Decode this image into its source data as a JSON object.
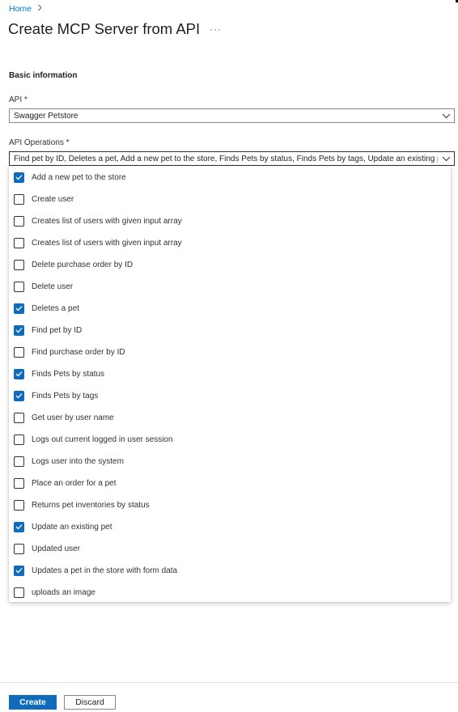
{
  "breadcrumb": {
    "home": "Home"
  },
  "page": {
    "title": "Create MCP Server from API",
    "more": "···"
  },
  "section": {
    "title": "Basic information"
  },
  "api_field": {
    "label": "API *",
    "value": "Swagger Petstore"
  },
  "operations_field": {
    "label": "API Operations *",
    "value": "Find pet by ID, Deletes a pet, Add a new pet to the store, Finds Pets by status, Finds Pets by tags, Update an existing p...",
    "options": [
      {
        "label": "Add a new pet to the store",
        "checked": true
      },
      {
        "label": "Create user",
        "checked": false
      },
      {
        "label": "Creates list of users with given input array",
        "checked": false
      },
      {
        "label": "Creates list of users with given input array",
        "checked": false
      },
      {
        "label": "Delete purchase order by ID",
        "checked": false
      },
      {
        "label": "Delete user",
        "checked": false
      },
      {
        "label": "Deletes a pet",
        "checked": true
      },
      {
        "label": "Find pet by ID",
        "checked": true
      },
      {
        "label": "Find purchase order by ID",
        "checked": false
      },
      {
        "label": "Finds Pets by status",
        "checked": true
      },
      {
        "label": "Finds Pets by tags",
        "checked": true
      },
      {
        "label": "Get user by user name",
        "checked": false
      },
      {
        "label": "Logs out current logged in user session",
        "checked": false
      },
      {
        "label": "Logs user into the system",
        "checked": false
      },
      {
        "label": "Place an order for a pet",
        "checked": false
      },
      {
        "label": "Returns pet inventories by status",
        "checked": false
      },
      {
        "label": "Update an existing pet",
        "checked": true
      },
      {
        "label": "Updated user",
        "checked": false
      },
      {
        "label": "Updates a pet in the store with form data",
        "checked": true
      },
      {
        "label": "uploads an image",
        "checked": false
      }
    ]
  },
  "footer": {
    "create_label": "Create",
    "discard_label": "Discard"
  },
  "colors": {
    "accent": "#0f6cbd",
    "link": "#0078d4"
  }
}
